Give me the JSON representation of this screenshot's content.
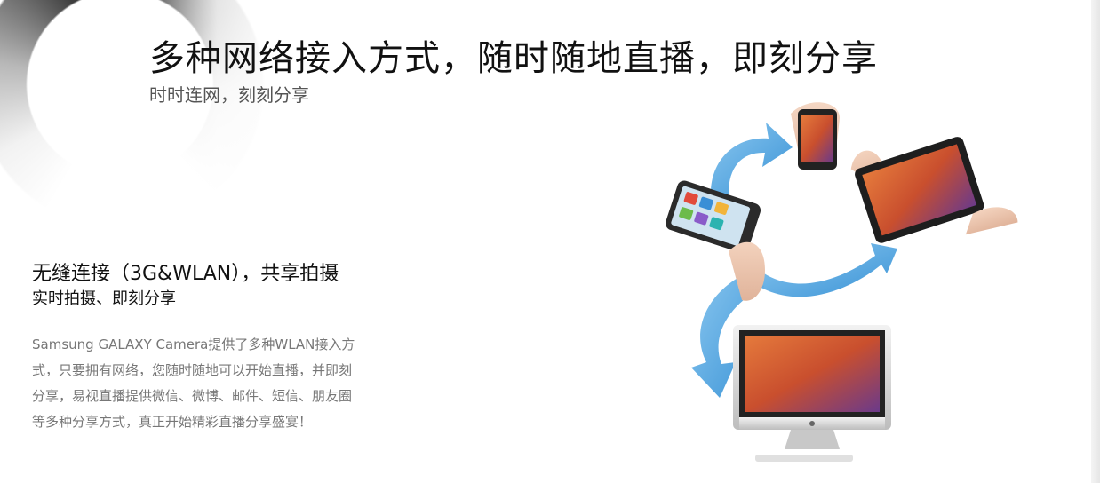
{
  "header": {
    "title": "多种网络接入方式，随时随地直播，即刻分享",
    "subtitle": "时时连网，刻刻分享"
  },
  "feature": {
    "heading": "无缝连接（3G&WLAN），共享拍摄",
    "subheading": "实时拍摄、即刻分享",
    "description": "Samsung GALAXY Camera提供了多种WLAN接入方式，只要拥有网络，您随时随地可以开始直播，并即刻分享，易视直播提供微信、微博、邮件、短信、朋友圈等多种分享方式，真正开始精彩直播分享盛宴！"
  },
  "colors": {
    "arrow_blue": "#4aa3e0",
    "title_text": "#111111",
    "description_text": "#777777"
  },
  "illustration": {
    "devices": [
      "camera",
      "smartphone",
      "tablet",
      "imac-computer"
    ]
  }
}
